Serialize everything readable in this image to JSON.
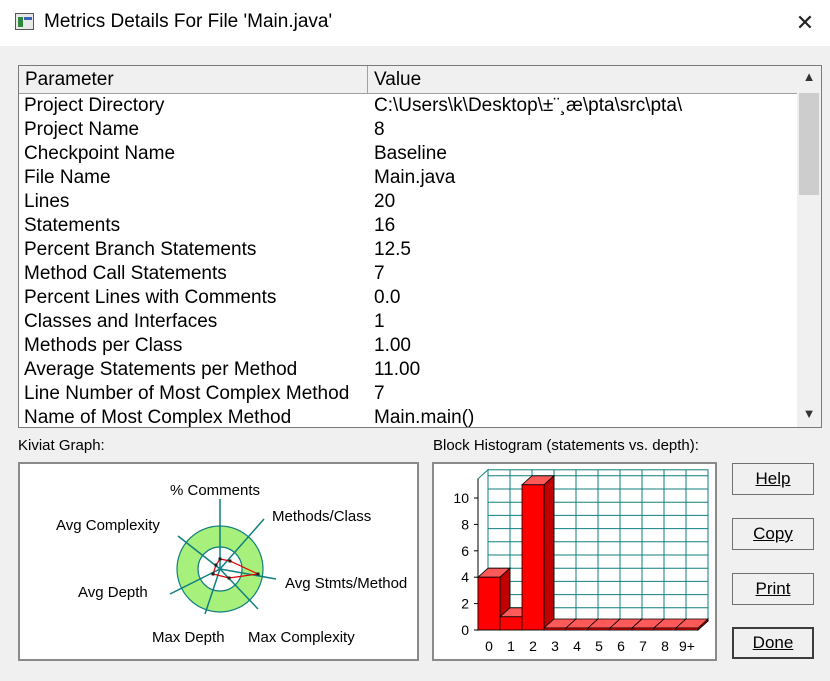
{
  "window": {
    "title": "Metrics Details For File 'Main.java'",
    "close_glyph": "✕"
  },
  "table": {
    "columns": [
      "Parameter",
      "Value"
    ],
    "rows": [
      {
        "p": "Project Directory",
        "v": "C:\\Users\\k\\Desktop\\±¨¸æ\\pta\\src\\pta\\"
      },
      {
        "p": "Project Name",
        "v": "8"
      },
      {
        "p": "Checkpoint Name",
        "v": "Baseline"
      },
      {
        "p": "File Name",
        "v": "Main.java"
      },
      {
        "p": "Lines",
        "v": "20"
      },
      {
        "p": "Statements",
        "v": "16"
      },
      {
        "p": "Percent Branch Statements",
        "v": "12.5"
      },
      {
        "p": "Method Call Statements",
        "v": "7"
      },
      {
        "p": "Percent Lines with Comments",
        "v": "0.0"
      },
      {
        "p": "Classes and Interfaces",
        "v": "1"
      },
      {
        "p": "Methods per Class",
        "v": "1.00"
      },
      {
        "p": "Average Statements per Method",
        "v": "11.00"
      },
      {
        "p": "Line Number of Most Complex Method",
        "v": "7"
      },
      {
        "p": "Name of Most Complex Method",
        "v": "Main.main()"
      }
    ]
  },
  "kiviat": {
    "label": "Kiviat Graph:",
    "axes": [
      "% Comments",
      "Methods/Class",
      "Avg Stmts/Method",
      "Max Complexity",
      "Max Depth",
      "Avg Depth",
      "Avg Complexity"
    ]
  },
  "histogram": {
    "label": "Block Histogram (statements vs. depth):",
    "chart_data": {
      "type": "bar",
      "xlabel": "",
      "ylabel": "",
      "categories": [
        "0",
        "1",
        "2",
        "3",
        "4",
        "5",
        "6",
        "7",
        "8",
        "9+"
      ],
      "values": [
        4,
        1,
        11,
        0,
        0,
        0,
        0,
        0,
        0,
        0
      ],
      "ylim": [
        0,
        11
      ],
      "yticks": [
        "0",
        "2",
        "4",
        "6",
        "8",
        "10"
      ],
      "grid": true,
      "bar_color": "#ff0000"
    }
  },
  "buttons": {
    "help": "Help",
    "copy": "Copy",
    "print": "Print",
    "done": "Done"
  },
  "icons": {
    "scroll_up": "▲",
    "scroll_down": "▼"
  },
  "colors": {
    "kiviat_ring": "#a8f07c",
    "kiviat_spokes": "#0f7f7f",
    "bar": "#ff0000"
  }
}
